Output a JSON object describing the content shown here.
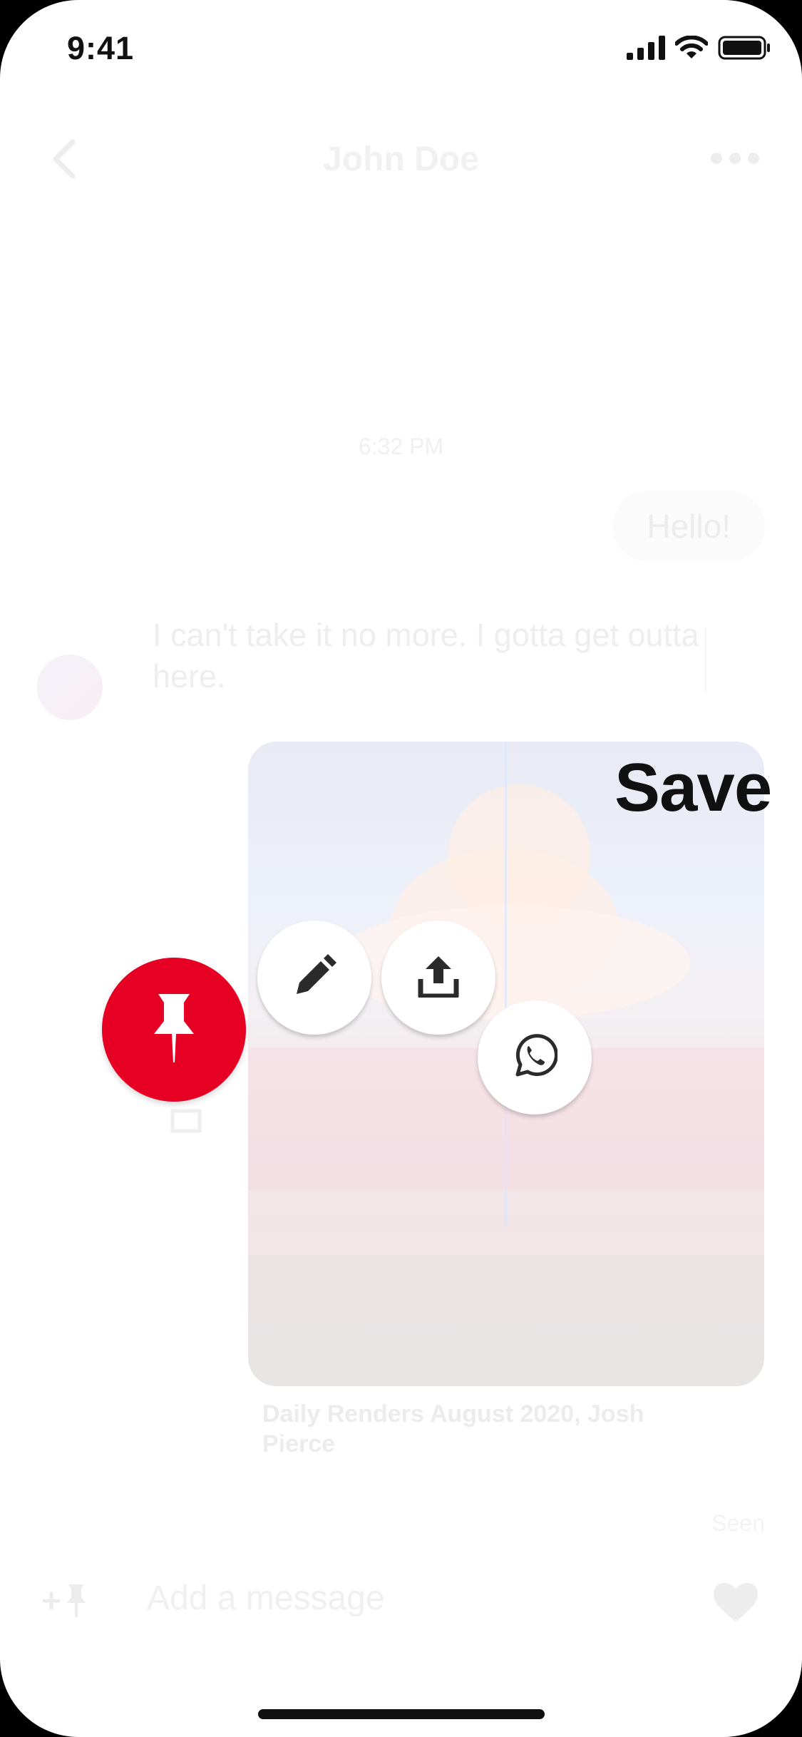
{
  "status_bar": {
    "time": "9:41"
  },
  "header": {
    "title": "John Doe"
  },
  "chat": {
    "timestamp": "6:32 PM",
    "messages": [
      {
        "sender": "me",
        "text": "Hello!"
      },
      {
        "sender": "them",
        "text": "I can't take it no more. I gotta get outta here."
      }
    ],
    "pin_caption": "Daily Renders August 2020, Josh Pierce",
    "seen": "Seen"
  },
  "composer": {
    "placeholder": "Add a message"
  },
  "overlay": {
    "save_label": "Save",
    "actions": [
      "pin-icon",
      "pencil-icon",
      "share-upload-icon",
      "whatsapp-icon"
    ],
    "pin_color": "#e60023"
  }
}
